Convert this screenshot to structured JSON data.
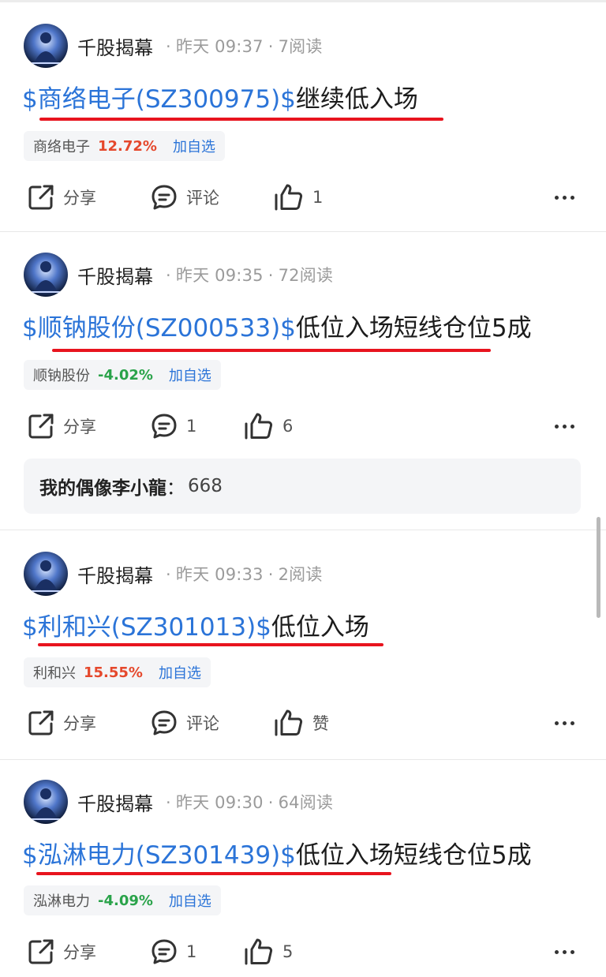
{
  "posts": [
    {
      "author": "千股揭幕",
      "time": "昨天 09:37",
      "reads": "7阅读",
      "title_tag": "$商络电子(SZ300975)$",
      "title_rest": "继续低入场",
      "stock_name": "商络电子",
      "stock_change": "12.72%",
      "watch_label": "加自选",
      "share_label": "分享",
      "comment_label": "评论",
      "like_label": "1"
    },
    {
      "author": "千股揭幕",
      "time": "昨天 09:35",
      "reads": "72阅读",
      "title_tag": "$顺钠股份(SZ000533)$",
      "title_rest": "低位入场短线仓位5成",
      "stock_name": "顺钠股份",
      "stock_change": "-4.02%",
      "watch_label": "加自选",
      "share_label": "分享",
      "comment_label": "1",
      "like_label": "6",
      "top_comment": {
        "user": "我的偶像李小龍",
        "colon": "：",
        "text": "668"
      }
    },
    {
      "author": "千股揭幕",
      "time": "昨天 09:33",
      "reads": "2阅读",
      "title_tag": "$利和兴(SZ301013)$",
      "title_rest": "低位入场",
      "stock_name": "利和兴",
      "stock_change": "15.55%",
      "watch_label": "加自选",
      "share_label": "分享",
      "comment_label": "评论",
      "like_label": "赞"
    },
    {
      "author": "千股揭幕",
      "time": "昨天 09:30",
      "reads": "64阅读",
      "title_tag": "$泓淋电力(SZ301439)$",
      "title_rest": "低位入场短线仓位5成",
      "stock_name": "泓淋电力",
      "stock_change": "-4.09%",
      "watch_label": "加自选",
      "share_label": "分享",
      "comment_label": "1",
      "like_label": "5"
    }
  ],
  "colors": {
    "link_blue": "#2b74d8",
    "rise_red": "#e5482c",
    "fall_green": "#2aa34a",
    "annotation_red": "#e8141e"
  },
  "icons": {
    "share": "share-icon",
    "comment": "comment-icon",
    "like": "thumbs-up-icon",
    "more": "more-icon",
    "avatar": "buddha-avatar"
  }
}
